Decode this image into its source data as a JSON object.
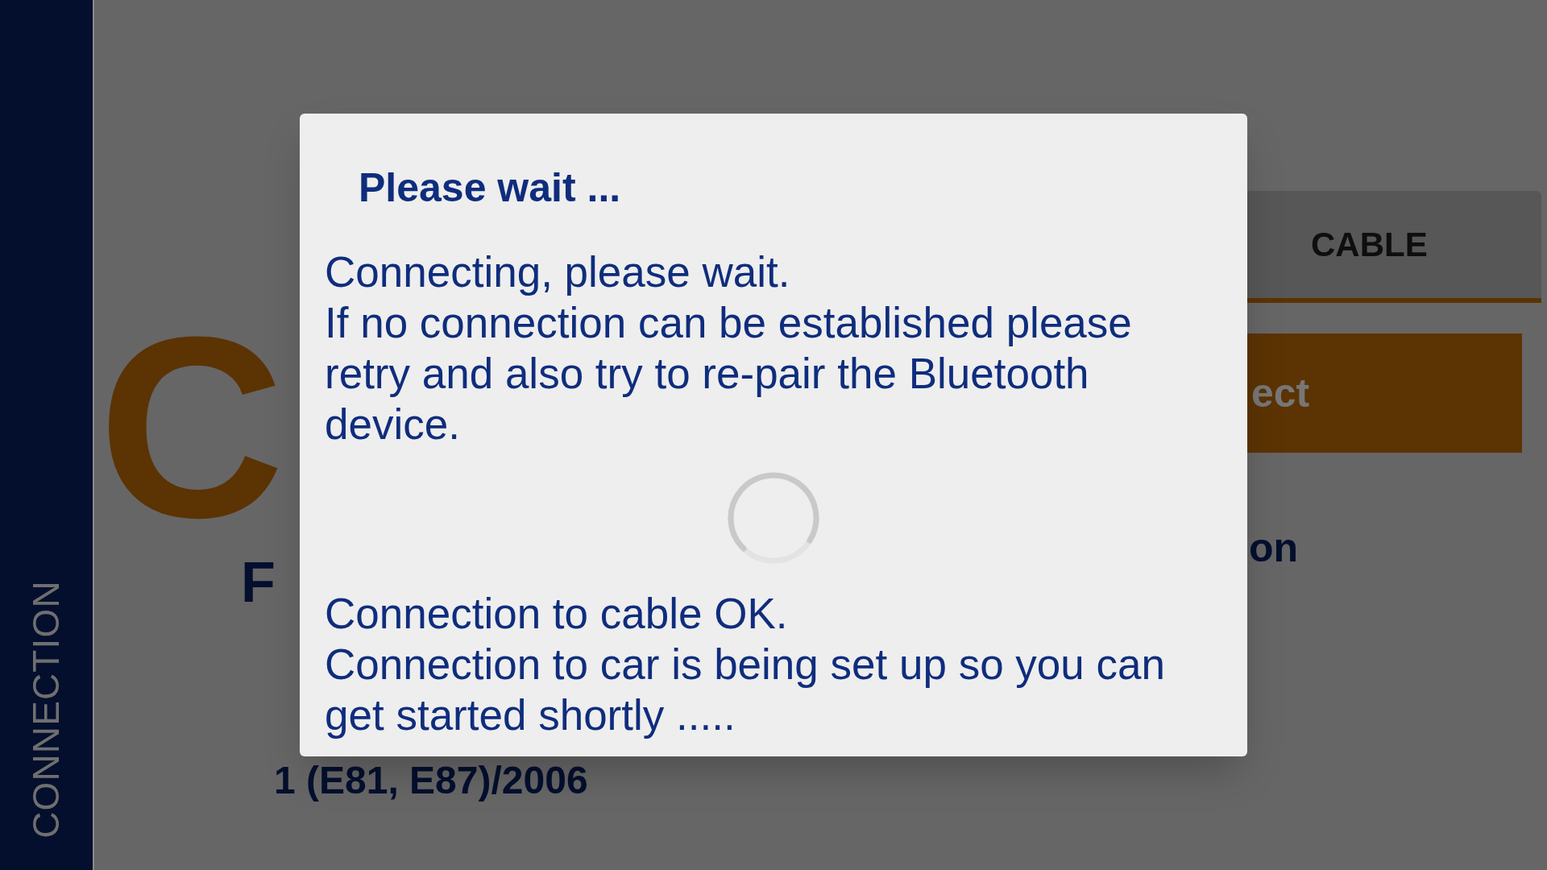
{
  "sidebar": {
    "label": "CONNECTION"
  },
  "background": {
    "logo": "C",
    "logo_subtitle": "F",
    "vehicle": "1 (E81, E87)/2006",
    "tab": {
      "label": "CABLE",
      "selected": true
    },
    "connect_button": "ect",
    "status": "on"
  },
  "dialog": {
    "title": "Please wait ...",
    "message_top": [
      "Connecting, please wait.",
      "If no connection can be established please retry and also try to re-pair the Bluetooth device."
    ],
    "message_bottom": [
      "Connection to cable OK.",
      "Connection to car is being set up so you can get started shortly ....."
    ]
  }
}
